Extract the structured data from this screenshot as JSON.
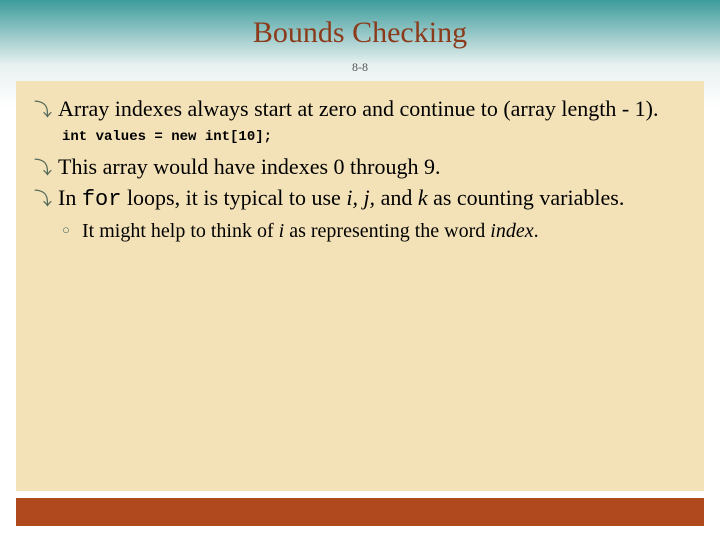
{
  "title": "Bounds Checking",
  "slide_number": "8-8",
  "bullets": {
    "b1_pre": "Array indexes always start at zero and continue to (array length - 1).",
    "code": "int values = new int[10];",
    "b2": "This array would have indexes 0 through 9.",
    "b3_pre": "In ",
    "b3_code": "for",
    "b3_mid": " loops, it is typical to use ",
    "b3_i": "i, j,",
    "b3_and": " and ",
    "b3_k": "k",
    "b3_post": " as counting variables.",
    "sub1_pre": "It might help to think of ",
    "sub1_i": "i",
    "sub1_mid": " as representing the word ",
    "sub1_index": "index",
    "sub1_post": "."
  },
  "colors": {
    "title": "#8b3a1a",
    "content_bg": "#f3e2b8",
    "footer": "#b04a1e",
    "header_grad_top": "#3d9b9b"
  }
}
